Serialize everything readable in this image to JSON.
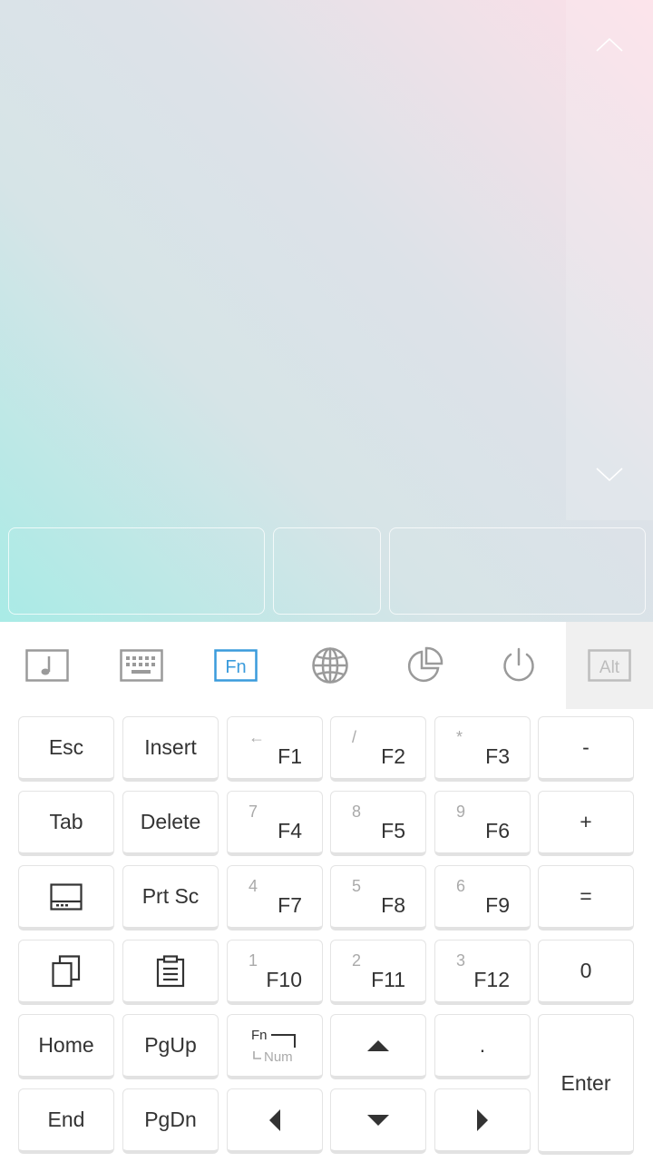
{
  "colors": {
    "accent": "#3a9bdc",
    "icon_gray": "#9a9a9a",
    "key_text": "#333333",
    "secondary_text": "#aaaaaa"
  },
  "touchpad": {
    "scroll_up_icon": "chevron-up-icon",
    "scroll_down_icon": "chevron-down-icon"
  },
  "toolbar": {
    "items": [
      {
        "icon": "music-icon"
      },
      {
        "icon": "keyboard-icon"
      },
      {
        "icon": "fn-icon",
        "label": "Fn",
        "active": true
      },
      {
        "icon": "globe-icon"
      },
      {
        "icon": "pie-chart-icon"
      },
      {
        "icon": "power-icon"
      },
      {
        "icon": "alt-icon",
        "label": "Alt"
      }
    ]
  },
  "keys": {
    "esc": "Esc",
    "insert": "Insert",
    "f1": "F1",
    "f1_sub": "←",
    "f2": "F2",
    "f2_sub": "/",
    "f3": "F3",
    "f3_sub": "*",
    "minus": "-",
    "tab": "Tab",
    "delete": "Delete",
    "f4": "F4",
    "f4_sub": "7",
    "f5": "F5",
    "f5_sub": "8",
    "f6": "F6",
    "f6_sub": "9",
    "plus": "+",
    "prtsc": "Prt Sc",
    "f7": "F7",
    "f7_sub": "4",
    "f8": "F8",
    "f8_sub": "5",
    "f9": "F9",
    "f9_sub": "6",
    "equals": "=",
    "f10": "F10",
    "f10_sub": "1",
    "f11": "F11",
    "f11_sub": "2",
    "f12": "F12",
    "f12_sub": "3",
    "zero": "0",
    "home": "Home",
    "pgup": "PgUp",
    "fn_toggle_top": "Fn",
    "fn_toggle_bottom": "Num",
    "period": ".",
    "enter": "Enter",
    "end": "End",
    "pgdn": "PgDn"
  }
}
